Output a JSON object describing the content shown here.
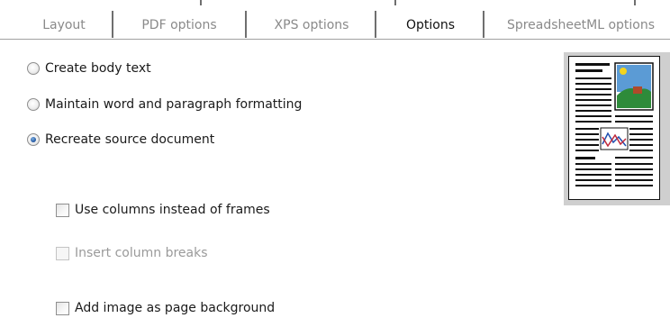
{
  "tabs": [
    {
      "label": "Layout",
      "active": false
    },
    {
      "label": "PDF options",
      "active": false
    },
    {
      "label": "XPS options",
      "active": false
    },
    {
      "label": "Options",
      "active": true
    },
    {
      "label": "SpreadsheetML options",
      "active": false
    }
  ],
  "layout_mode": {
    "options": [
      {
        "label": "Create body text",
        "selected": false
      },
      {
        "label": "Maintain word and paragraph formatting",
        "selected": false
      },
      {
        "label": "Recreate source document",
        "selected": true
      }
    ]
  },
  "checkboxes": [
    {
      "label": "Use columns instead of frames",
      "checked": false,
      "enabled": true
    },
    {
      "label": "Insert column breaks",
      "checked": false,
      "enabled": false
    },
    {
      "label": "Add image as page background",
      "checked": false,
      "enabled": true
    }
  ],
  "preview": {
    "icon": "document-layout-preview-icon"
  },
  "colors": {
    "tab_separator": "#6f6f6f",
    "disabled_text": "#9a9a9a",
    "radio_selected": "#2a5fa8",
    "preview_sky": "#5b9bd5",
    "preview_sun": "#f2d41f",
    "preview_hill": "#2e8b3a",
    "preview_house": "#b04a2a"
  }
}
